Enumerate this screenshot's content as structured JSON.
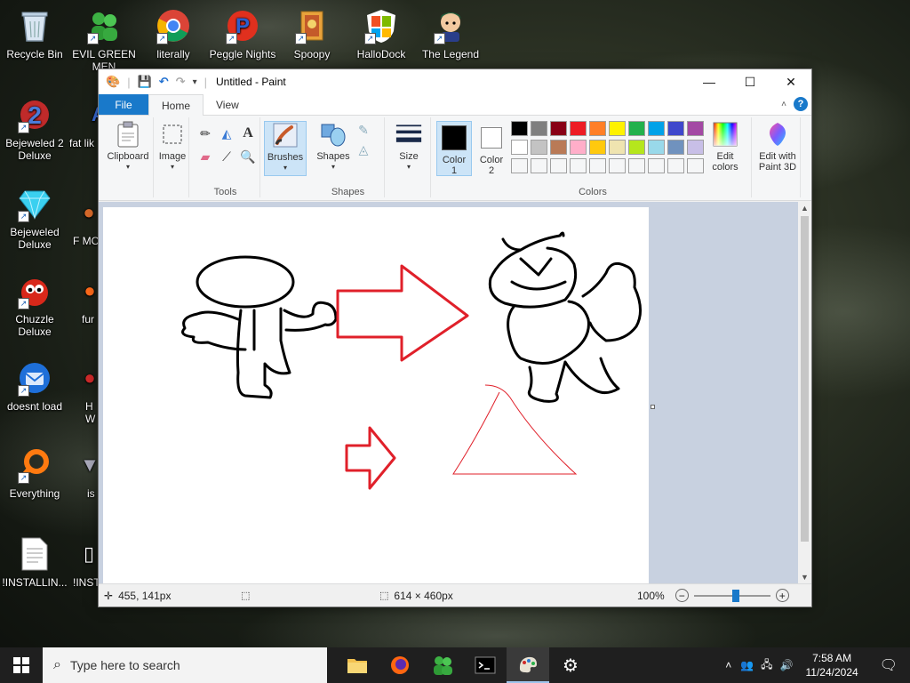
{
  "desktop": {
    "icons": [
      {
        "label": "Recycle Bin"
      },
      {
        "label": "EVIL GREEN MEN"
      },
      {
        "label": "literally"
      },
      {
        "label": "Peggle Nights"
      },
      {
        "label": "Spoopy"
      },
      {
        "label": "HalloDock"
      },
      {
        "label": "The Legend"
      },
      {
        "label": "Bejeweled 2 Deluxe"
      },
      {
        "label": "fat lik"
      },
      {
        "label": "Bejeweled Deluxe"
      },
      {
        "label": "F MON"
      },
      {
        "label": "Chuzzle Deluxe"
      },
      {
        "label": "fur"
      },
      {
        "label": "doesnt load"
      },
      {
        "label": "H W"
      },
      {
        "label": "Everything"
      },
      {
        "label": "is"
      },
      {
        "label": "!INSTALLIN..."
      },
      {
        "label": "!INST - Sh"
      }
    ]
  },
  "paint": {
    "title": "Untitled - Paint",
    "tabs": {
      "file": "File",
      "home": "Home",
      "view": "View"
    },
    "groups": {
      "clipboard": "Clipboard",
      "image": "Image",
      "tools": "Tools",
      "brushes": "Brushes",
      "shapes_btn": "Shapes",
      "shapes": "Shapes",
      "size": "Size",
      "color1": "Color",
      "color1_num": "1",
      "color2": "Color",
      "color2_num": "2",
      "colors": "Colors",
      "edit_colors": "Edit colors",
      "edit_paint3d": "Edit with Paint 3D"
    },
    "palette_row1": [
      "#000000",
      "#7f7f7f",
      "#880015",
      "#ed1c24",
      "#ff7f27",
      "#fff200",
      "#22b14c",
      "#00a2e8",
      "#3f48cc",
      "#a349a4"
    ],
    "palette_row2": [
      "#ffffff",
      "#c3c3c3",
      "#b97a57",
      "#ffaec9",
      "#ffc90e",
      "#efe4b0",
      "#b5e61d",
      "#99d9ea",
      "#7092be",
      "#c8bfe7"
    ],
    "color1_value": "#000000",
    "color2_value": "#ffffff",
    "status": {
      "cursor_pos": "455, 141px",
      "canvas_size": "614 × 460px",
      "zoom": "100%",
      "zoom_fraction": 0.55
    }
  },
  "taskbar": {
    "search_placeholder": "Type here to search",
    "time": "7:58 AM",
    "date": "11/24/2024"
  }
}
